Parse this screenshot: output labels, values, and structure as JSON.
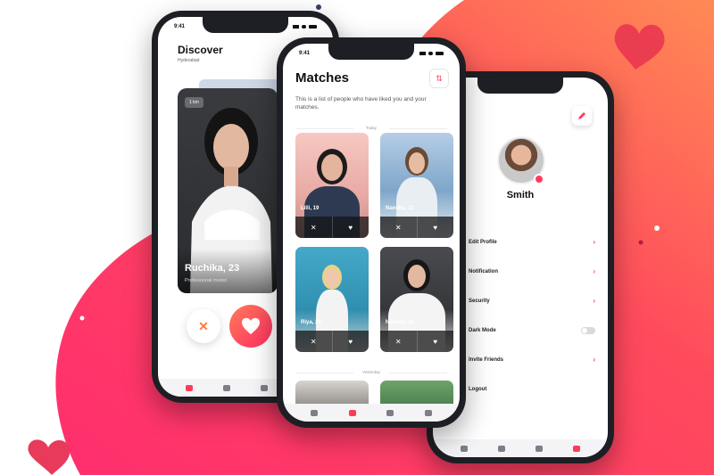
{
  "colors": {
    "accent": "#ff3b5c",
    "gradient_start": "#ff2e63",
    "gradient_end": "#ff7a45"
  },
  "discover": {
    "status_time": "9:41",
    "title": "Discover",
    "subtitle": "Hyderabad",
    "card": {
      "distance": "1 km",
      "name": "Ruchika, 23",
      "role": "Professional model"
    },
    "actions": {
      "dislike_icon": "cross-icon",
      "like_icon": "heart-icon"
    }
  },
  "matches": {
    "status_time": "9:41",
    "title": "Matches",
    "description": "This is a list of people who have liked you and your matches.",
    "section_today": "Today",
    "section_yesterday": "Yesterday",
    "cards": [
      {
        "name": "Lilli, 19"
      },
      {
        "name": "Nandita, 21"
      },
      {
        "name": "Riya, 24"
      },
      {
        "name": "Nandita, 23"
      }
    ]
  },
  "profile": {
    "name": "Smith",
    "menu": [
      {
        "label": "Edit Profile",
        "control": "chevron"
      },
      {
        "label": "Notification",
        "control": "chevron"
      },
      {
        "label": "Security",
        "control": "chevron"
      },
      {
        "label": "Dark Mode",
        "control": "toggle"
      },
      {
        "label": "Invite Friends",
        "control": "chevron"
      },
      {
        "label": "Logout",
        "control": "none"
      }
    ]
  }
}
